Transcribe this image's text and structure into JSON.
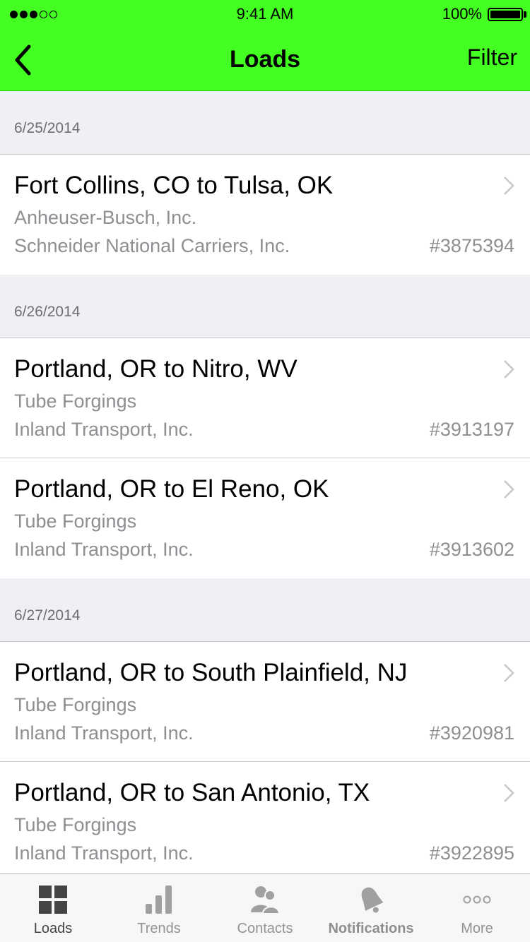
{
  "status_bar": {
    "time": "9:41 AM",
    "battery": "100%",
    "signal_bars_filled": 3,
    "signal_bars_total": 5
  },
  "nav": {
    "title": "Loads",
    "filter_label": "Filter"
  },
  "sections": [
    {
      "date": "6/25/2014",
      "loads": [
        {
          "route": "Fort Collins, CO to Tulsa, OK",
          "shipper": "Anheuser-Busch, Inc.",
          "carrier": "Schneider National Carriers, Inc.",
          "number": "#3875394"
        }
      ]
    },
    {
      "date": "6/26/2014",
      "loads": [
        {
          "route": "Portland, OR to Nitro, WV",
          "shipper": "Tube Forgings",
          "carrier": "Inland Transport, Inc.",
          "number": "#3913197"
        },
        {
          "route": "Portland, OR to El Reno, OK",
          "shipper": "Tube Forgings",
          "carrier": "Inland Transport, Inc.",
          "number": "#3913602"
        }
      ]
    },
    {
      "date": "6/27/2014",
      "loads": [
        {
          "route": "Portland, OR to South Plainfield, NJ",
          "shipper": "Tube Forgings",
          "carrier": "Inland Transport, Inc.",
          "number": "#3920981"
        },
        {
          "route": "Portland, OR to San Antonio, TX",
          "shipper": "Tube Forgings",
          "carrier": "Inland Transport, Inc.",
          "number": "#3922895"
        }
      ]
    }
  ],
  "tabs": [
    {
      "label": "Loads",
      "icon": "grid-icon",
      "active": true
    },
    {
      "label": "Trends",
      "icon": "bar-chart-icon",
      "active": false
    },
    {
      "label": "Contacts",
      "icon": "contacts-icon",
      "active": false
    },
    {
      "label": "Notifications",
      "icon": "bell-icon",
      "active": false
    },
    {
      "label": "More",
      "icon": "more-icon",
      "active": false
    }
  ],
  "colors": {
    "accent": "#44ff22",
    "secondary_text": "#8e8e93",
    "section_bg": "#efeff4"
  }
}
